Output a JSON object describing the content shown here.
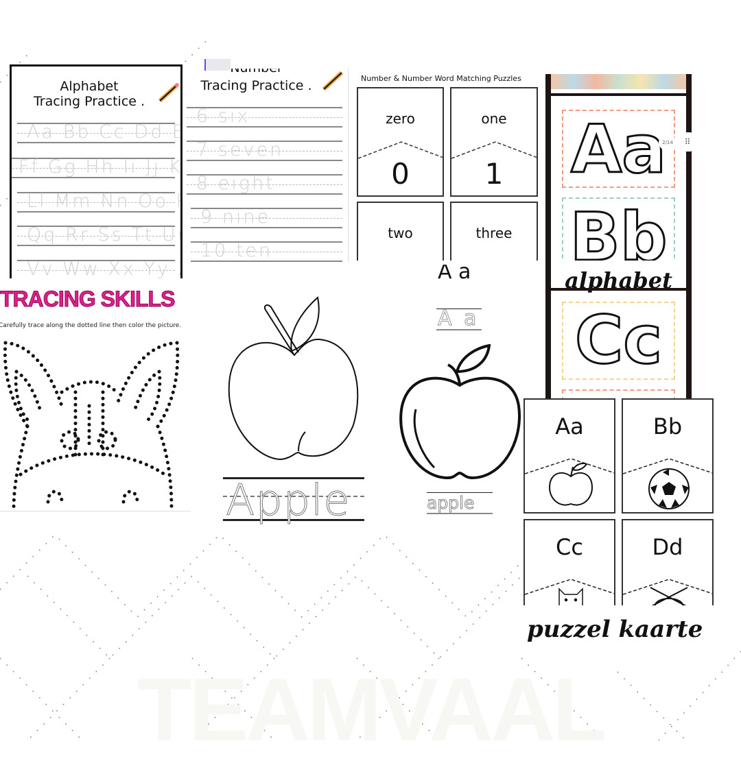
{
  "watermark": "TEAMVAAL",
  "alphabet_tracing": {
    "title_line1": "Alphabet",
    "title_line2": "Tracing Practice .",
    "rows": [
      "Aa Bb Cc Dd Ee",
      "Ff Gg Hh Ii Jj Kk",
      "Ll Mm Nn Oo Pp",
      "Qq Rr Ss Tt Uu",
      "Vv Ww Xx Yy Zz"
    ]
  },
  "number_tracing": {
    "title_line1": "Number",
    "title_line2": "Tracing Practice .",
    "rows": [
      "6 six",
      "7 seven",
      "8 eight",
      "9 nine",
      "10 ten"
    ]
  },
  "number_puzzles": {
    "title": "Number & Number Word Matching Puzzles",
    "cards": [
      {
        "word": "zero",
        "number": "0"
      },
      {
        "word": "one",
        "number": "1"
      },
      {
        "word": "two",
        "number": ""
      },
      {
        "word": "three",
        "number": ""
      }
    ]
  },
  "alphabet_cards": {
    "letters": [
      "Aa",
      "Bb",
      "Cc"
    ],
    "label": "alphabet",
    "page_badge": "2/14",
    "border_colors": [
      "#f19a7f",
      "#9ccfbf",
      "#f7d48e"
    ],
    "frame_color": "#1e1414"
  },
  "tracing_skills": {
    "title": "TRACING SKILLS",
    "subtitle": "Carefully trace along the dotted line then color the picture.",
    "title_color": "#e21d8c"
  },
  "apple_sheet_1": {
    "word": "Apple"
  },
  "apple_sheet_2": {
    "letters": "A a",
    "traced_letters": "A a",
    "word": "apple"
  },
  "puzzle_cards": {
    "cards": [
      {
        "letter": "Aa",
        "picture": "apple-icon"
      },
      {
        "letter": "Bb",
        "picture": "soccer-ball-icon"
      },
      {
        "letter": "Cc",
        "picture": "cat-icon"
      },
      {
        "letter": "Dd",
        "picture": "bug-icon"
      }
    ],
    "label": "puzzel kaarte"
  }
}
